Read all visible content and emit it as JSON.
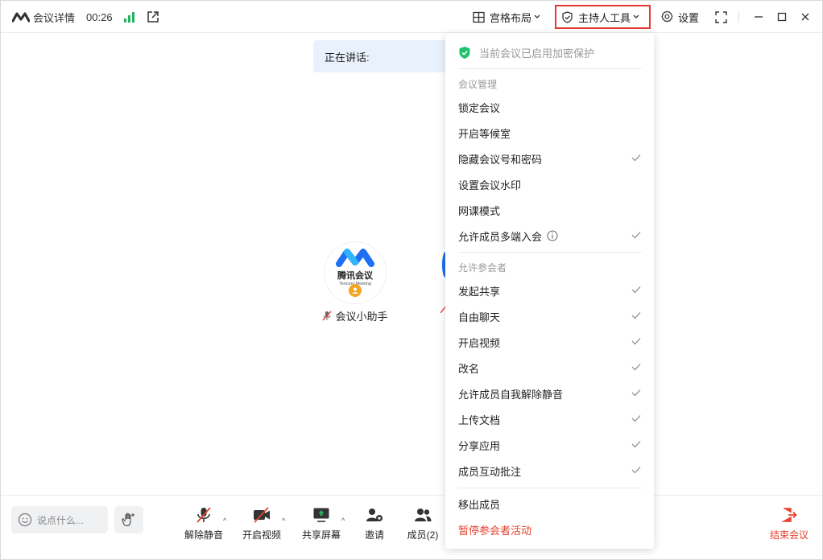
{
  "titlebar": {
    "meeting_details": "会议详情",
    "timer": "00:26",
    "layout_label": "宫格布局",
    "host_tools_label": "主持人工具",
    "settings_label": "设置"
  },
  "stage": {
    "speaking_label": "正在讲话:",
    "participant": {
      "avatar_brand": "腾讯会议",
      "avatar_sub": "Tencent Meeting",
      "name": "会议小助手"
    }
  },
  "menu": {
    "encryption_notice": "当前会议已启用加密保护",
    "section_manage": "会议管理",
    "manage_items": [
      {
        "label": "锁定会议",
        "checked": false
      },
      {
        "label": "开启等候室",
        "checked": false
      },
      {
        "label": "隐藏会议号和密码",
        "checked": true
      },
      {
        "label": "设置会议水印",
        "checked": false
      },
      {
        "label": "网课模式",
        "checked": false
      },
      {
        "label": "允许成员多端入会",
        "checked": true
      }
    ],
    "section_allow": "允许参会者",
    "allow_items": [
      {
        "label": "发起共享",
        "checked": true
      },
      {
        "label": "自由聊天",
        "checked": true
      },
      {
        "label": "开启视频",
        "checked": true
      },
      {
        "label": "改名",
        "checked": true
      },
      {
        "label": "允许成员自我解除静音",
        "checked": true
      },
      {
        "label": "上传文档",
        "checked": true
      },
      {
        "label": "分享应用",
        "checked": true
      },
      {
        "label": "成员互动批注",
        "checked": true
      }
    ],
    "remove_member": "移出成员",
    "pause_activity": "暂停参会者活动"
  },
  "bottombar": {
    "chat_placeholder": "说点什么...",
    "unmute": "解除静音",
    "start_video": "开启视频",
    "share_screen": "共享屏幕",
    "invite": "邀请",
    "members": "成员(2)",
    "end_meeting": "结束会议"
  },
  "colors": {
    "accent_blue": "#1e6ff1",
    "highlight_red": "#e53935",
    "danger": "#e5412e",
    "signal_green": "#22b35e",
    "shield_green": "#1ec26b",
    "badge_orange": "#f5a524"
  }
}
